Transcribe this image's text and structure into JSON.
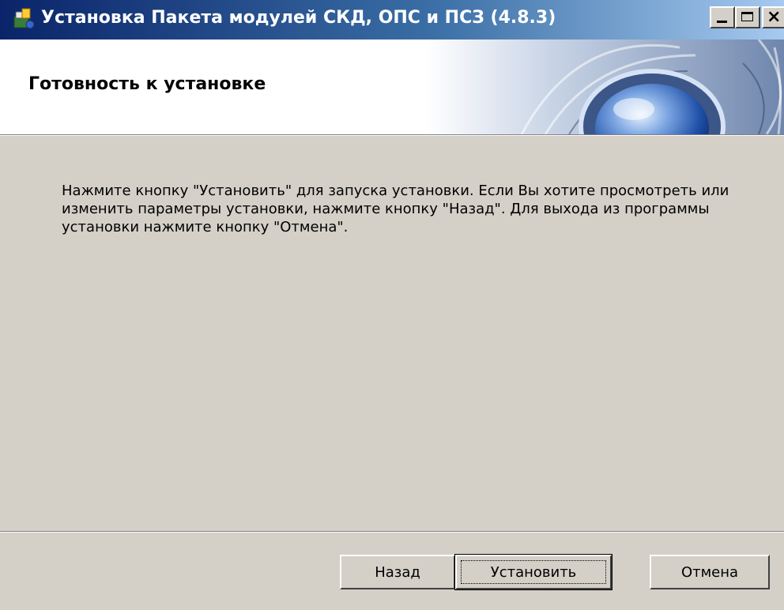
{
  "window": {
    "title": "Установка Пакета модулей СКД, ОПС и ПСЗ (4.8.3)",
    "icon": "installer-icon"
  },
  "banner": {
    "title": "Готовность к установке"
  },
  "body": {
    "text": "Нажмите кнопку \"Установить\" для запуска установки. Если Вы хотите просмотреть или изменить параметры установки, нажмите кнопку \"Назад\". Для выхода из программы установки нажмите кнопку \"Отмена\"."
  },
  "buttons": {
    "back": "Назад",
    "install": "Установить",
    "cancel": "Отмена"
  },
  "colors": {
    "dialog_bg": "#d4d0c8",
    "titlebar_start": "#0a246a",
    "titlebar_end": "#a6caf0"
  }
}
